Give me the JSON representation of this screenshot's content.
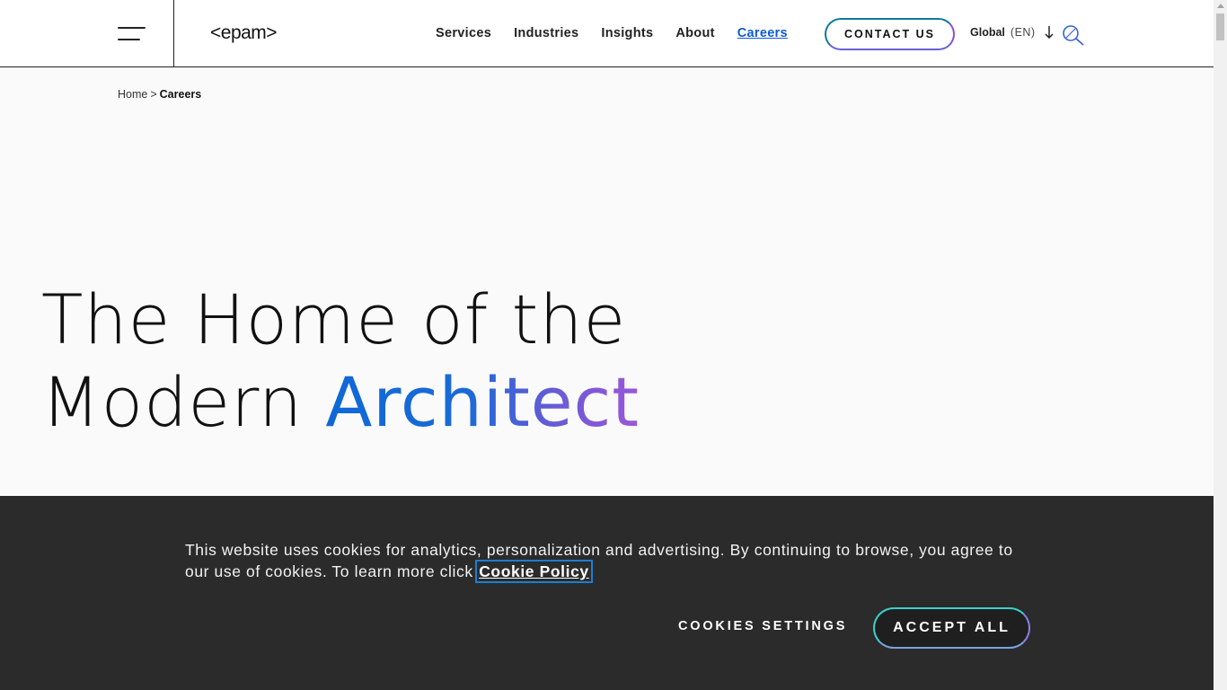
{
  "header": {
    "logo_text": "<epam>",
    "nav": [
      {
        "label": "Services"
      },
      {
        "label": "Industries"
      },
      {
        "label": "Insights"
      },
      {
        "label": "About"
      },
      {
        "label": "Careers",
        "active": true
      }
    ],
    "contact_label": "CONTACT US",
    "language": {
      "region": "Global",
      "code": "(EN)"
    }
  },
  "breadcrumb": {
    "home": "Home",
    "separator": ">",
    "current": "Careers"
  },
  "hero": {
    "line1": "The Home of the",
    "line2_plain": "Modern ",
    "line2_accent": "Architect"
  },
  "cookie_banner": {
    "text": "This website uses cookies for analytics, personalization and advertising. By continuing to browse, you agree to our use of cookies. To learn more click ",
    "link_label": "Cookie Policy",
    "settings_label": "COOKIES SETTINGS",
    "accept_label": "ACCEPT ALL"
  },
  "colors": {
    "accent_blue": "#0f5bd4",
    "accent_purple": "#9a57d8",
    "banner_bg": "#2b2b2b"
  }
}
